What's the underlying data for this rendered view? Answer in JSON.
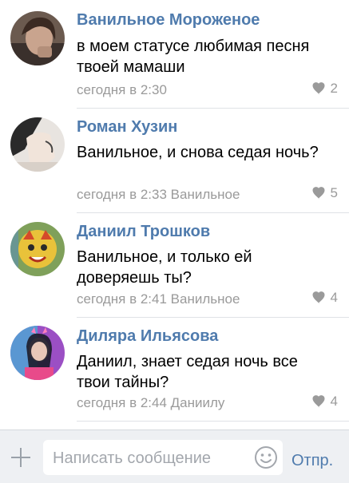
{
  "comments": [
    {
      "author": "Ванильное Мороженое",
      "text": "в моем статусе любимая песня твоей мамаши",
      "meta": "сегодня в 2:30",
      "likes": "2"
    },
    {
      "author": "Роман Хузин",
      "text": "Ванильное, и снова седая ночь?",
      "meta": "сегодня в 2:33 Ванильное",
      "likes": "5"
    },
    {
      "author": "Даниил Трошков",
      "text": "Ванильное, и только ей доверяешь ты?",
      "meta": "сегодня в 2:41 Ванильное",
      "likes": "4"
    },
    {
      "author": "Диляра Ильясова",
      "text": "Даниил, знает седая ночь все твои тайны?",
      "meta": "сегодня в 2:44 Даниилу",
      "likes": "4"
    }
  ],
  "composer": {
    "placeholder": "Написать сообщение",
    "send_label": "Отпр."
  },
  "icons": {
    "like": "heart-icon",
    "attach": "plus-icon",
    "emoji": "smile-icon"
  },
  "colors": {
    "author": "#4f7bad",
    "meta": "#9a9a9a",
    "composer_bg": "#eef0f3"
  }
}
